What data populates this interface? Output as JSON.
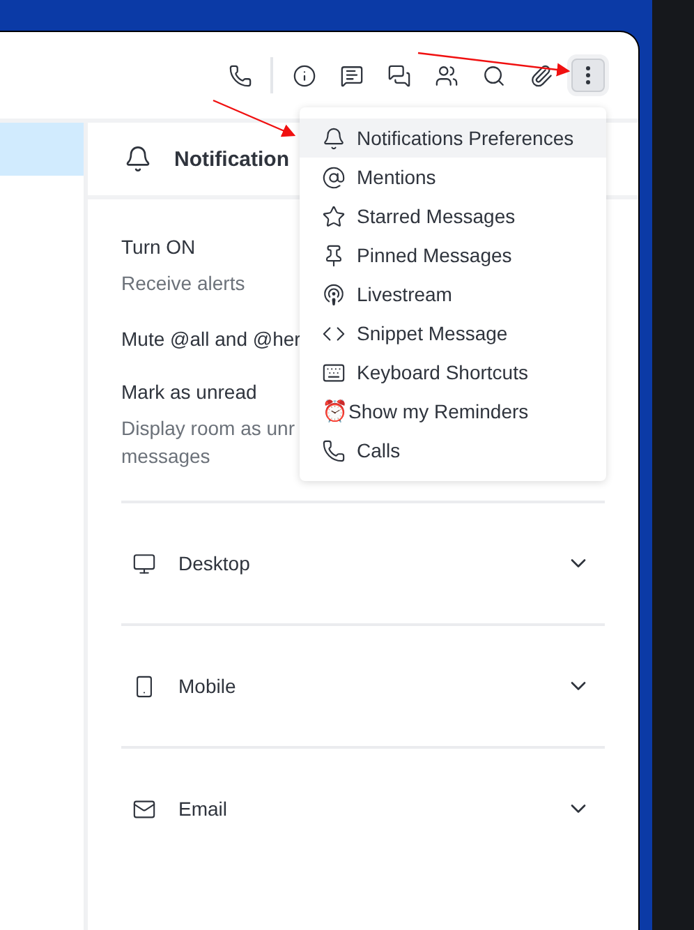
{
  "sidebar": {
    "items": [
      {
        "selected": true
      }
    ]
  },
  "panel": {
    "title": "Notification",
    "settings": [
      {
        "label": "Turn ON",
        "hint": "Receive alerts"
      },
      {
        "label": "Mute @all and @her"
      },
      {
        "label": "Mark as unread",
        "hint": "Display room as unr",
        "hint_more": "messages"
      }
    ],
    "sections": [
      {
        "label": "Desktop",
        "expanded": false
      },
      {
        "label": "Mobile",
        "expanded": false
      },
      {
        "label": "Email",
        "expanded": false
      }
    ]
  },
  "menu": {
    "items": [
      {
        "label": "Notifications Preferences",
        "selected": true
      },
      {
        "label": "Mentions",
        "selected": false
      },
      {
        "label": "Starred Messages",
        "selected": false
      },
      {
        "label": "Pinned Messages",
        "selected": false
      },
      {
        "label": "Livestream",
        "selected": false
      },
      {
        "label": "Snippet Message",
        "selected": false
      },
      {
        "label": "Keyboard Shortcuts",
        "selected": false
      },
      {
        "label": "Show my Reminders",
        "kind": "emoji",
        "emoji": "⏰",
        "selected": false
      },
      {
        "label": "Calls",
        "selected": false
      }
    ]
  }
}
